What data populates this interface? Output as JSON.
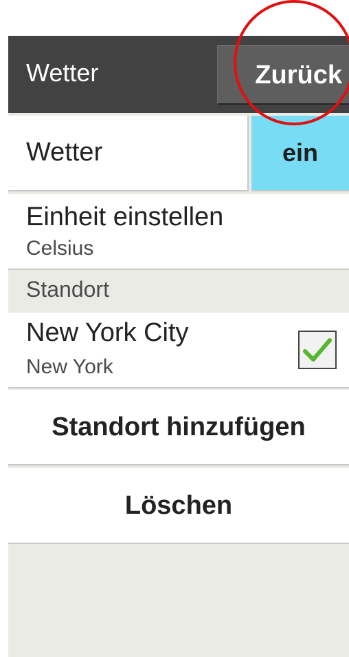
{
  "header": {
    "title": "Wetter",
    "back_label": "Zurück"
  },
  "weather": {
    "label": "Wetter",
    "toggle_state": "ein"
  },
  "unit": {
    "title": "Einheit einstellen",
    "value": "Celsius"
  },
  "location_section": {
    "label": "Standort",
    "items": [
      {
        "city": "New York City",
        "region": "New York",
        "checked": true
      }
    ]
  },
  "actions": {
    "add_location": "Standort hinzufügen",
    "delete": "Löschen"
  },
  "colors": {
    "header_bg": "#424242",
    "toggle_on": "#78dcf5",
    "check_green": "#55b82e",
    "annotation_red": "#e01010"
  }
}
